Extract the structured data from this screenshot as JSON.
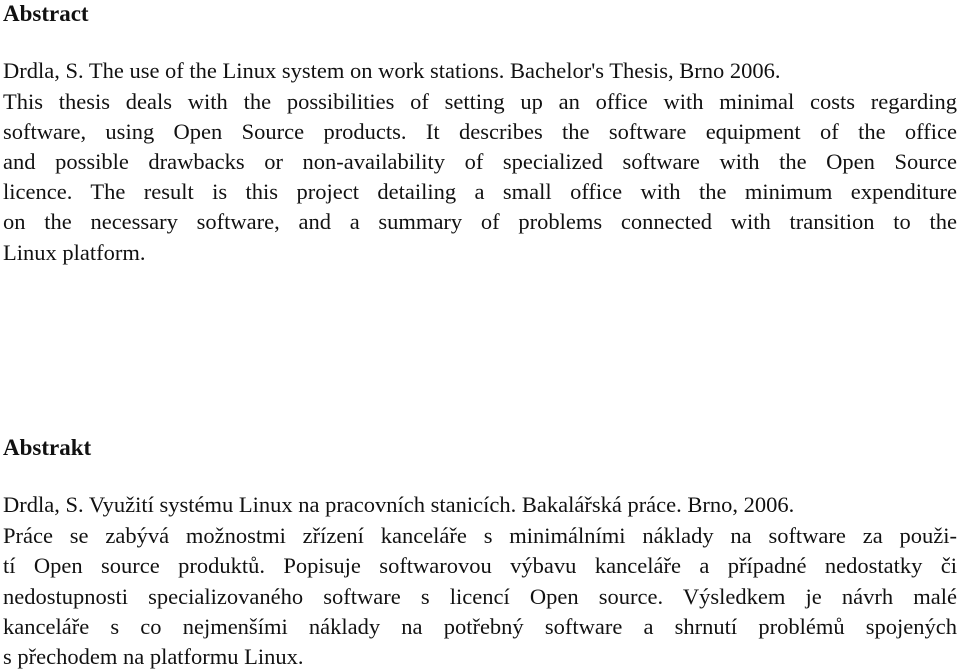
{
  "english": {
    "heading": "Abstract",
    "lines": [
      "Drdla, S. The use of the Linux system on work stations. Bachelor's Thesis, Brno 2006.",
      "This thesis deals with the possibilities of setting up an office with minimal costs regarding",
      "software, using Open Source products. It describes the software equipment of the office",
      "and possible drawbacks or non-availability of specialized software with the Open Source",
      "licence. The result is this project detailing a small office with the minimum expenditure",
      "on the necessary software, and a summary of problems connected with transition to the",
      "Linux platform."
    ]
  },
  "czech": {
    "heading": "Abstrakt",
    "lines": [
      "Drdla, S. Využití systému Linux na pracovních stanicích. Bakalářská práce. Brno, 2006.",
      "Práce se zabývá možnostmi zřízení kanceláře s minimálními náklady na software za použi-",
      "tí Open source produktů. Popisuje softwarovou výbavu kanceláře a případné nedostatky či",
      "nedostupnosti specializovaného software s licencí Open source. Výsledkem je návrh malé",
      "kanceláře s co nejmenšími náklady na potřebný software a shrnutí problémů spojených",
      "s přechodem na platformu Linux."
    ]
  }
}
